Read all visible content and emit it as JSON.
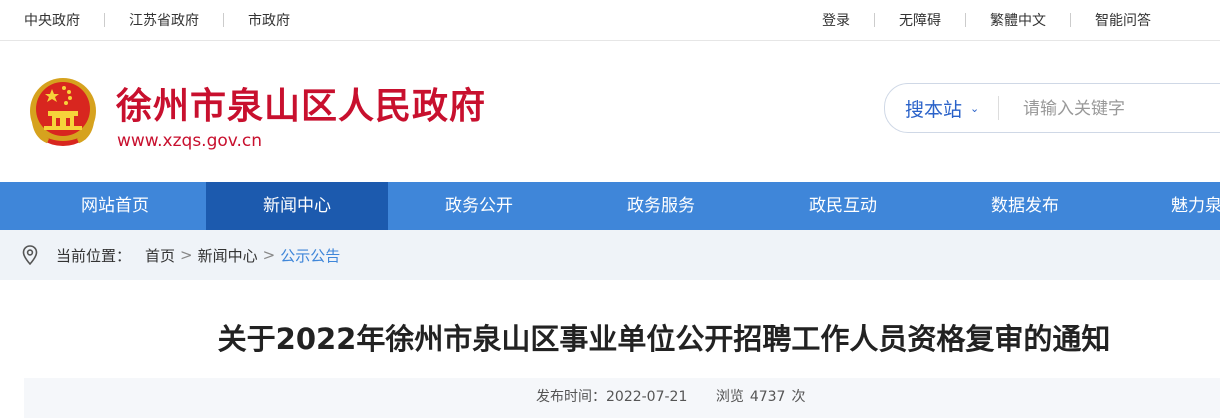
{
  "topbar": {
    "left_links": [
      "中央政府",
      "江苏省政府",
      "市政府"
    ],
    "right_links": [
      "登录",
      "无障碍",
      "繁體中文",
      "智能问答"
    ]
  },
  "header": {
    "title": "徐州市泉山区人民政府",
    "url": "www.xzqs.gov.cn",
    "emblem_icon": "national-emblem-icon",
    "brand_color": "#c8102e"
  },
  "search": {
    "scope": "搜本站",
    "placeholder": "请输入关键字"
  },
  "nav": {
    "color": "#3f86d9",
    "active_color": "#1c5aae",
    "items": [
      {
        "label": "网站首页"
      },
      {
        "label": "新闻中心",
        "active": true
      },
      {
        "label": "政务公开"
      },
      {
        "label": "政务服务"
      },
      {
        "label": "政民互动"
      },
      {
        "label": "数据发布"
      },
      {
        "label": "魅力泉山"
      }
    ]
  },
  "breadcrumb": {
    "prefix": "当前位置：",
    "items": [
      "首页",
      "新闻中心",
      "公示公告"
    ],
    "separator": ">"
  },
  "article": {
    "title": "关于2022年徐州市泉山区事业单位公开招聘工作人员资格复审的通知",
    "publish_label": "发布时间：",
    "publish_date": "2022-07-21",
    "views_label": "浏览",
    "views_count": "4737",
    "views_unit": "次"
  }
}
